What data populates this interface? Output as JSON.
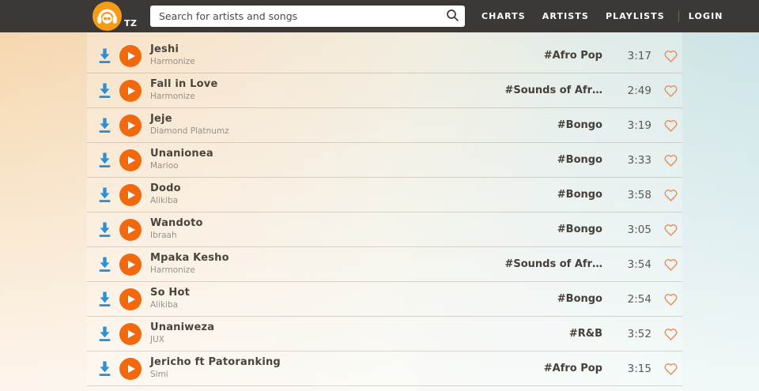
{
  "header": {
    "logo": {
      "icon": "headphones-logo-icon",
      "region_label": "TZ"
    },
    "search": {
      "placeholder": "Search for artists and songs",
      "icon": "search-icon",
      "value": ""
    },
    "nav": [
      {
        "label": "CHARTS"
      },
      {
        "label": "ARTISTS"
      },
      {
        "label": "PLAYLISTS"
      },
      {
        "label": "LOGIN",
        "divider_before": true
      }
    ]
  },
  "songs": [
    {
      "title": "Jeshi",
      "artist": "Harmonize",
      "tag": "#Afro Pop",
      "duration": "3:17"
    },
    {
      "title": "Fall in Love",
      "artist": "Harmonize",
      "tag": "#Sounds of Afr…",
      "duration": "2:49"
    },
    {
      "title": "Jeje",
      "artist": "Diamond Platnumz",
      "tag": "#Bongo",
      "duration": "3:19"
    },
    {
      "title": "Unanionea",
      "artist": "Marioo",
      "tag": "#Bongo",
      "duration": "3:33"
    },
    {
      "title": "Dodo",
      "artist": "Alikiba",
      "tag": "#Bongo",
      "duration": "3:58"
    },
    {
      "title": "Wandoto",
      "artist": "Ibraah",
      "tag": "#Bongo",
      "duration": "3:05"
    },
    {
      "title": "Mpaka Kesho",
      "artist": "Harmonize",
      "tag": "#Sounds of Afr…",
      "duration": "3:54"
    },
    {
      "title": "So Hot",
      "artist": "Alikiba",
      "tag": "#Bongo",
      "duration": "2:54"
    },
    {
      "title": "Unaniweza",
      "artist": "JUX",
      "tag": "#R&B",
      "duration": "3:52"
    },
    {
      "title": "Jericho ft Patoranking",
      "artist": "Simi",
      "tag": "#Afro Pop",
      "duration": "3:15"
    }
  ],
  "colors": {
    "header_bg": "#3b3835",
    "logo_orange": "#f49b18",
    "play_orange": "#f2680c",
    "download_blue": "#2f8fd0",
    "heart_orange": "#ef9058",
    "title_text": "#4a443c",
    "artist_text": "#95908a"
  }
}
